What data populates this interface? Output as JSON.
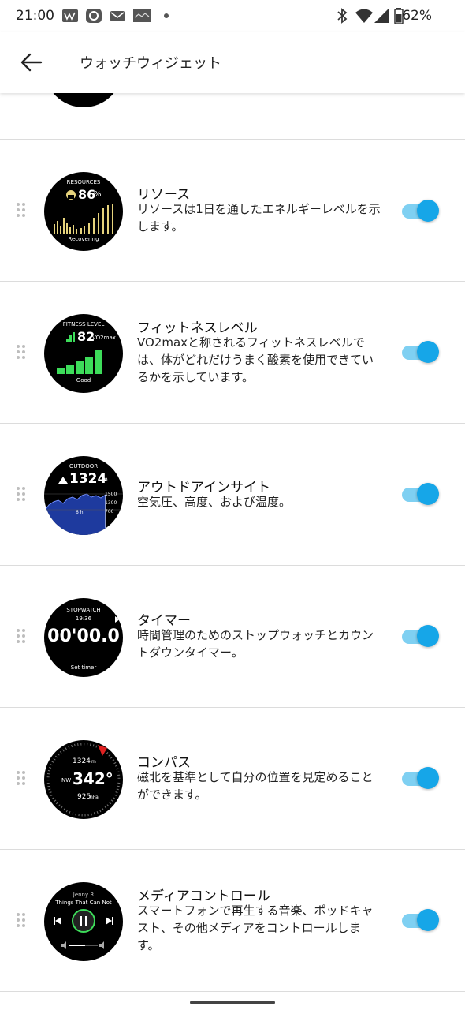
{
  "status_bar": {
    "time": "21:00",
    "left_icons": [
      "app-notification-icon",
      "assistant-icon",
      "mail-icon",
      "image-icon",
      "dot-icon"
    ],
    "right_icons": [
      "bluetooth-icon",
      "wifi-icon",
      "cellular-signal-icon",
      "battery-icon"
    ],
    "battery": "62%"
  },
  "header": {
    "title": "ウォッチウィジェット",
    "back_icon": "back-arrow-icon"
  },
  "colors": {
    "toggle_track": "#7fd0f2",
    "toggle_knob": "#16a6e8",
    "bar_yellow": "#e6d37c",
    "bar_green": "#3ddc5a",
    "chart_blue": "#2b4fd6"
  },
  "widgets": [
    {
      "title": "リソース",
      "description": "リソースは1日を通したエネルギーレベルを示します。",
      "enabled": true,
      "preview": {
        "heading": "RESOURCES",
        "value": "86",
        "unit": "%",
        "status": "Recovering",
        "resource_level": 0.86
      }
    },
    {
      "title": "フィットネスレベル",
      "description": "VO2maxと称されるフィットネスレベルでは、体がどれだけうまく酸素を使用できているかを示しています。",
      "enabled": true,
      "preview": {
        "heading": "FITNESS LEVEL",
        "value": "82",
        "unit": "VO2max",
        "status": "Good"
      }
    },
    {
      "title": "アウトドアインサイト",
      "description": "空気圧、高度、および温度。",
      "enabled": true,
      "preview": {
        "heading": "OUTDOOR",
        "value": "1324",
        "unit": "m",
        "axis_labels": [
          "1500",
          "1300",
          "700"
        ],
        "time_label": "6 h"
      }
    },
    {
      "title": "タイマー",
      "description": "時間管理のためのストップウォッチとカウントダウンタイマー。",
      "enabled": true,
      "preview": {
        "heading": "STOPWATCH",
        "clock": "19:36",
        "value": "00'00.0",
        "footer": "Set timer"
      }
    },
    {
      "title": "コンパス",
      "description": "磁北を基準として自分の位置を見定めることができます。",
      "enabled": true,
      "preview": {
        "altitude": "1324",
        "altitude_unit": "m",
        "direction": "NW",
        "heading_value": "342°",
        "pressure": "925",
        "pressure_unit": "hPa"
      }
    },
    {
      "title": "メディアコントロール",
      "description": "スマートフォンで再生する音楽、ポッドキャスト、その他メディアをコントロールします。",
      "enabled": true,
      "preview": {
        "artist": "Jenny R",
        "track": "Things That Can Not"
      }
    }
  ]
}
